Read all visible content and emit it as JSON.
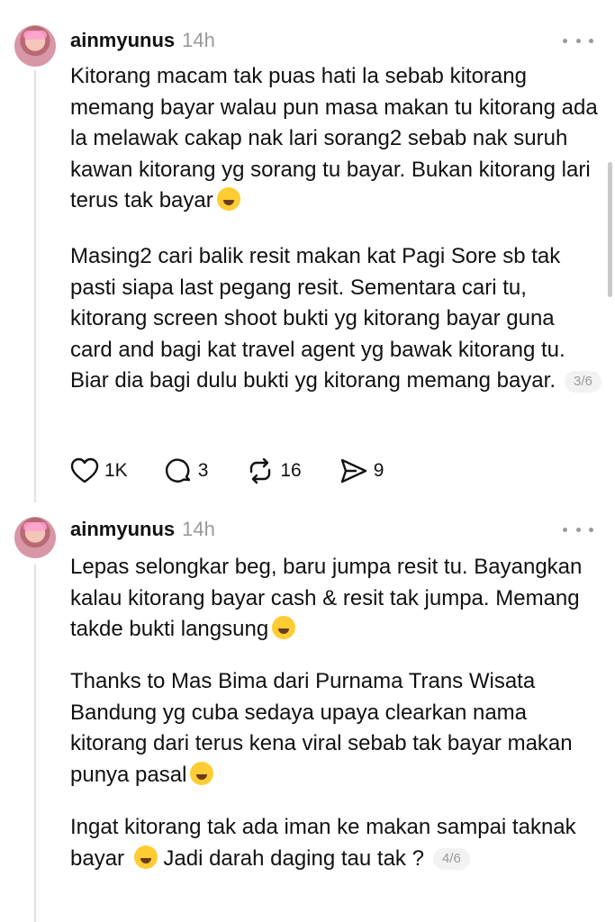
{
  "posts": [
    {
      "username": "ainmyunus",
      "time": "14h",
      "paragraphs": [
        "Kitorang macam tak puas hati la sebab kitorang memang bayar walau pun masa makan tu kitorang ada la melawak cakap nak lari sorang2 sebab nak suruh kawan kitorang yg sorang tu bayar. Bukan kitorang lari terus tak bayar",
        "Masing2 cari balik resit makan kat Pagi Sore sb tak pasti siapa last pegang resit. Sementara cari tu, kitorang screen shoot bukti yg kitorang bayar guna card and bagi kat travel agent yg bawak kitorang tu. Biar dia bagi dulu bukti yg kitorang memang bayar."
      ],
      "pager": "3/6",
      "actions": {
        "likes": "1K",
        "replies": "3",
        "reposts": "16",
        "shares": "9"
      }
    },
    {
      "username": "ainmyunus",
      "time": "14h",
      "paragraphs": [
        "Lepas selongkar beg, baru jumpa resit tu. Bayangkan kalau kitorang bayar cash & resit tak jumpa. Memang takde bukti langsung",
        "Thanks to Mas Bima dari Purnama Trans Wisata Bandung yg cuba sedaya upaya clearkan nama kitorang dari terus kena viral sebab tak bayar makan punya pasal",
        "Ingat kitorang tak ada iman ke makan sampai taknak bayar",
        "Jadi darah daging tau tak ?"
      ],
      "pager": "4/6"
    }
  ],
  "icons": [
    "avatar",
    "more-icon",
    "heart-icon",
    "reply-icon",
    "repost-icon",
    "share-icon",
    "emoji-laugh-cry",
    "emoji-loud-cry",
    "emoji-pleading"
  ]
}
